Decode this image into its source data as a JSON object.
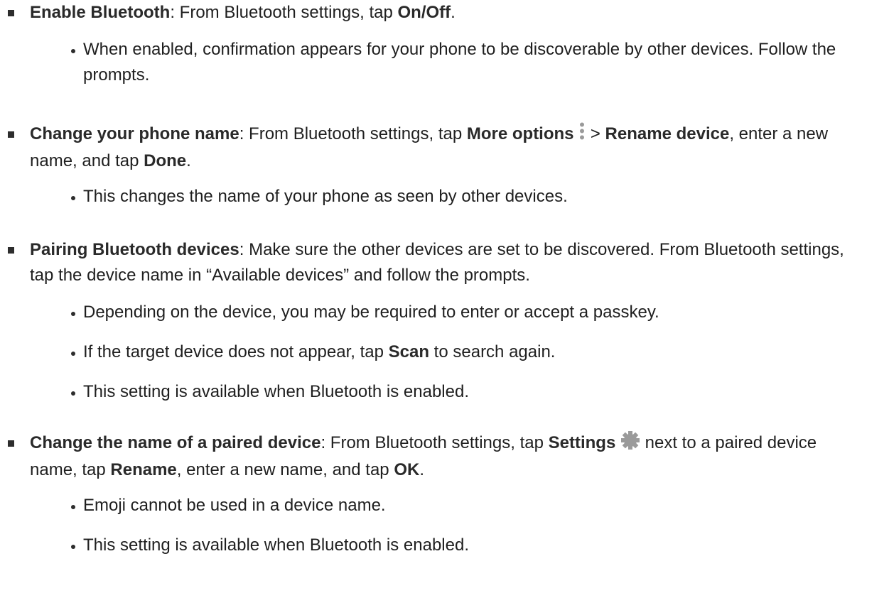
{
  "items": [
    {
      "title": "Enable Bluetooth",
      "sep": ": From Bluetooth settings, tap ",
      "b1": "On/Off",
      "end": ".",
      "subs": [
        "When enabled, confirmation appears for your phone to be discoverable by other devices. Follow the prompts."
      ]
    },
    {
      "title": "Change your phone name",
      "sep": ": From Bluetooth settings, tap ",
      "b1": "More options",
      "gt": " > ",
      "b2": "Rename device",
      "mid": ", enter a new name, and tap ",
      "b3": "Done",
      "end": ".",
      "icon": "more-options-icon",
      "subs": [
        "This changes the name of your phone as seen by other devices."
      ]
    },
    {
      "title": "Pairing Bluetooth devices",
      "text": ": Make sure the other devices are set to be discovered. From Bluetooth settings, tap the device name in “Available devices” and follow the prompts.",
      "subs": [
        "Depending on the device, you may be required to enter or accept a passkey.",
        {
          "pre": "If the target device does not appear, tap ",
          "b": "Scan",
          "post": " to search again."
        },
        "This setting is available when Bluetooth is enabled."
      ]
    },
    {
      "title": "Change the name of a paired device",
      "sep": ": From Bluetooth settings, tap ",
      "b1": "Settings",
      "mid1": " next to a paired device name, tap ",
      "b2": "Rename",
      "mid2": ", enter a new name, and tap ",
      "b3": "OK",
      "end": ".",
      "icon": "gear-icon",
      "subs": [
        "Emoji cannot be used in a device name.",
        "This setting is available when Bluetooth is enabled."
      ]
    }
  ],
  "colors": {
    "text": "#1f1f1f",
    "icon": "#9a9a9a"
  }
}
